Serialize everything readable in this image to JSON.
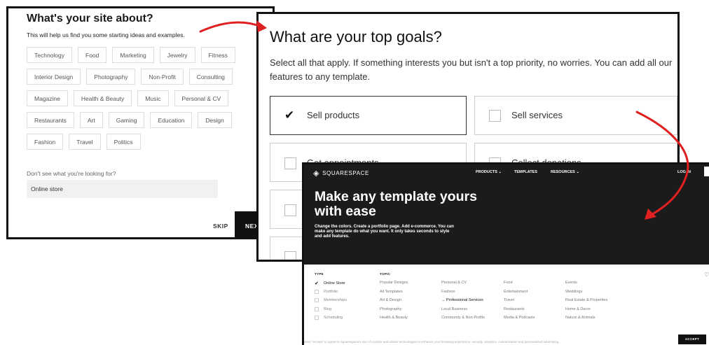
{
  "site_about": {
    "title": "What's your site about?",
    "subtitle": "This will help us find you some starting ideas and examples.",
    "tag_rows": [
      [
        "Technology",
        "Food",
        "Marketing",
        "Jewelry",
        "Fitness"
      ],
      [
        "Interior Design",
        "Photography",
        "Non-Profit",
        "Consulting"
      ],
      [
        "Magazine",
        "Health & Beauty",
        "Music",
        "Personal & CV"
      ],
      [
        "Restaurants",
        "Art",
        "Gaming",
        "Education",
        "Design"
      ],
      [
        "Fashion",
        "Travel",
        "Politics"
      ]
    ],
    "question": "Don't see what you're looking for?",
    "input_value": "Online store",
    "skip_label": "SKIP",
    "next_label": "NEXT"
  },
  "goals": {
    "title": "What are your top goals?",
    "subtitle": "Select all that apply. If something interests you but isn't a top priority, no worries. You can add all our features to any template.",
    "options": [
      {
        "label": "Sell products",
        "checked": true
      },
      {
        "label": "Sell services",
        "checked": false
      },
      {
        "label": "Get appointments",
        "checked": false
      },
      {
        "label": "Collect donations",
        "checked": false
      }
    ]
  },
  "squarespace": {
    "logo": "SQUARESPACE",
    "nav": [
      "PRODUCTS ⌄",
      "TEMPLATES",
      "RESOURCES ⌄"
    ],
    "login": "LOG IN",
    "hero_title": "Make any template yours with ease",
    "hero_sub": "Change the colors. Create a portfolio page. Add e-commerce. You can make any template do what you want. It only takes seconds to style and add features.",
    "type_header": "TYPE",
    "topic_header": "TOPIC",
    "types": [
      {
        "label": "Online Store",
        "checked": true
      },
      {
        "label": "Portfolio",
        "checked": false
      },
      {
        "label": "Memberships",
        "checked": false
      },
      {
        "label": "Blog",
        "checked": false
      },
      {
        "label": "Scheduling",
        "checked": false
      }
    ],
    "topics": [
      [
        "Popular Designs",
        "All Templates",
        "Art & Design",
        "Photography",
        "Health & Beauty"
      ],
      [
        "Personal & CV",
        "Fashion",
        "→ Professional Services",
        "Local Business",
        "Community & Non-Profits"
      ],
      [
        "Food",
        "Entertainment",
        "Travel",
        "Restaurants",
        "Media & Podcasts"
      ],
      [
        "Events",
        "Weddings",
        "Real Estate & Properties",
        "Home & Decor",
        "Nature & Animals"
      ]
    ],
    "active_topic": "→ Professional Services",
    "cookie_text": "elect \"Accept\" to agree to Squarespace's use of cookies and similar technologies to enhance your browsing experience, security, analytics, customization and personalized advertising.",
    "accept_label": "ACCEPT"
  },
  "colors": {
    "arrow": "#e02020",
    "dark": "#1b1b1b"
  }
}
